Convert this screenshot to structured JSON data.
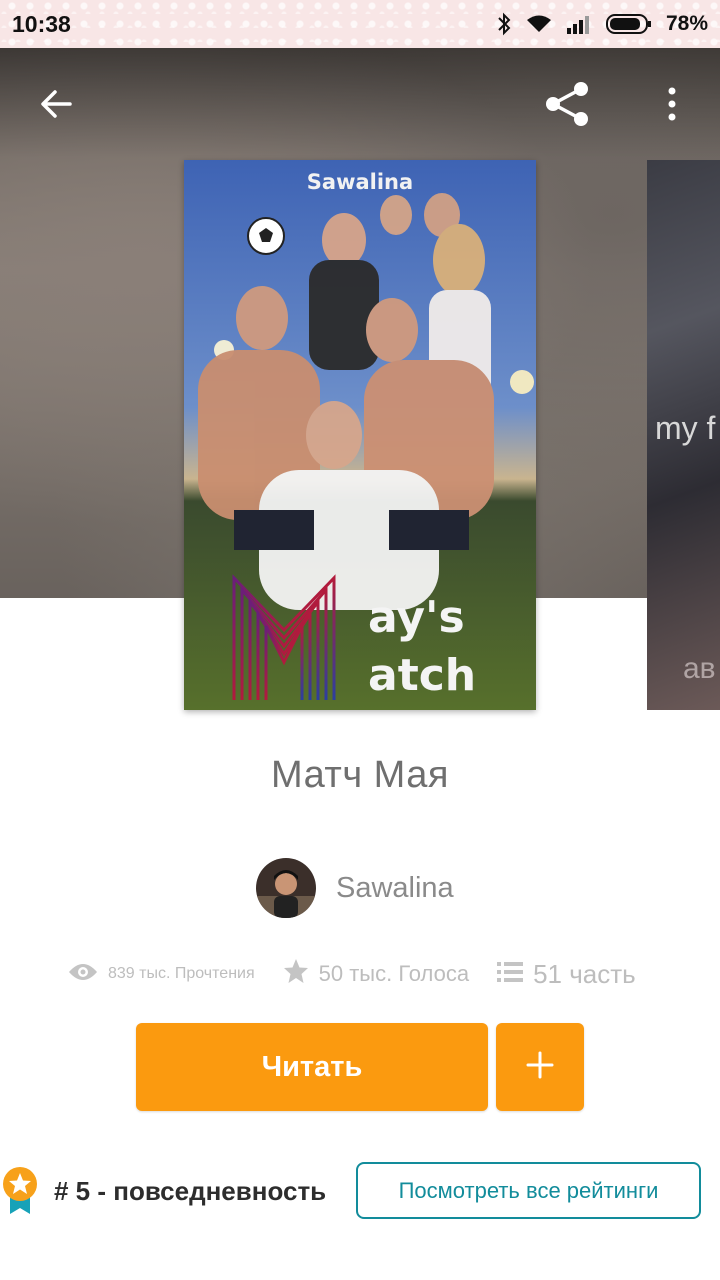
{
  "status_bar": {
    "time": "10:38",
    "battery_percent": "78%",
    "icons": [
      "bluetooth-icon",
      "wifi-icon",
      "signal-icon",
      "battery-icon"
    ]
  },
  "header": {
    "back_icon": "arrow-left-icon",
    "share_icon": "share-icon",
    "more_icon": "more-vertical-icon"
  },
  "cover": {
    "author_tag": "Sawalina",
    "title_line1": "ay's",
    "title_line2": "atch",
    "big_letter": "M"
  },
  "next_cover": {
    "text1": "my f",
    "text2": "ав"
  },
  "story": {
    "title": "Матч Мая",
    "author": "Sawalina"
  },
  "stats": {
    "reads": "839 тыс. Прочтения",
    "votes": "50 тыс. Голоса",
    "parts": "51 часть"
  },
  "actions": {
    "read_label": "Читать",
    "add_icon": "plus-icon"
  },
  "ranking": {
    "rank": "# 5 - повседневность",
    "view_all_label": "Посмотреть все рейтинги"
  },
  "colors": {
    "accent_orange": "#fb9a0f",
    "teal": "#128c9b",
    "status_bar_bg": "#f8e6e6"
  }
}
